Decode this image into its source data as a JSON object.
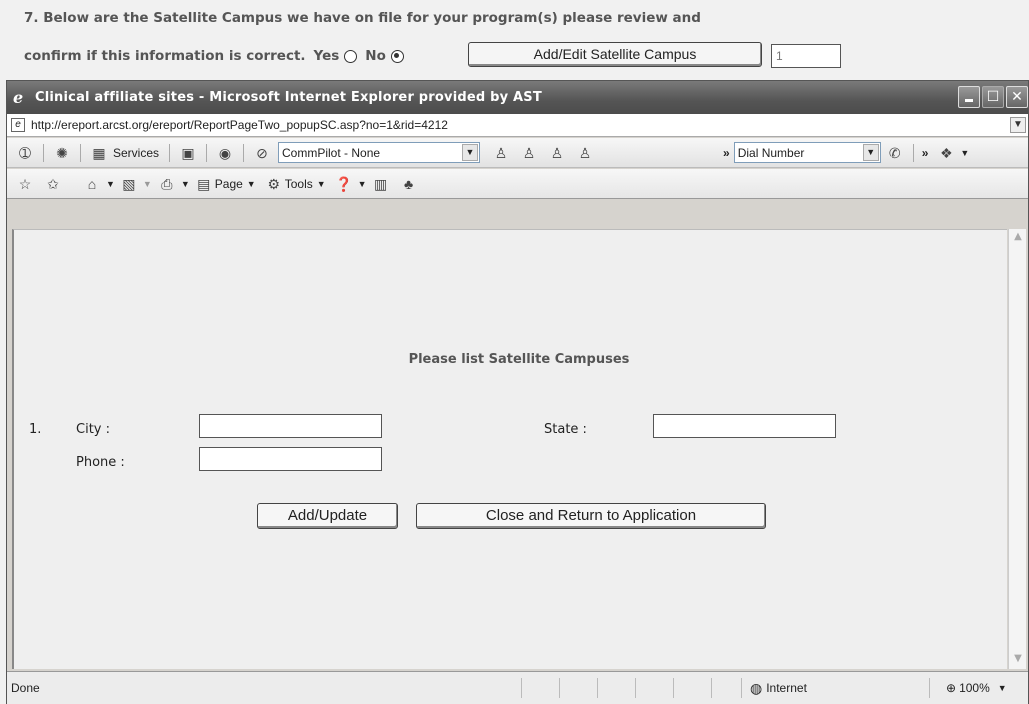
{
  "background": {
    "question_line1": "7. Below are the Satellite Campus we have on file for your program(s) please review and",
    "question_line2": "confirm if this information is correct.",
    "yes_label": "Yes",
    "no_label": "No",
    "selected": "No",
    "add_edit_button": "Add/Edit Satellite Campus",
    "count_value": "1"
  },
  "window": {
    "title": "Clinical affiliate sites - Microsoft Internet Explorer provided by AST",
    "address": "http://ereport.arcst.org/ereport/ReportPageTwo_popupSC.asp?no=1&rid=4212"
  },
  "toolbar1": {
    "services_label": "Services",
    "commpilot_value": "CommPilot - None",
    "dial_value": "Dial Number"
  },
  "toolbar2": {
    "page_label": "Page",
    "tools_label": "Tools"
  },
  "form": {
    "heading": "Please list Satellite Campuses",
    "row_number": "1.",
    "city_label": "City :",
    "state_label": "State :",
    "phone_label": "Phone :",
    "city_value": "",
    "state_value": "",
    "phone_value": "",
    "add_update_button": "Add/Update",
    "close_button": "Close and Return to Application"
  },
  "status": {
    "text": "Done",
    "zone": "Internet",
    "zoom": "100%"
  }
}
